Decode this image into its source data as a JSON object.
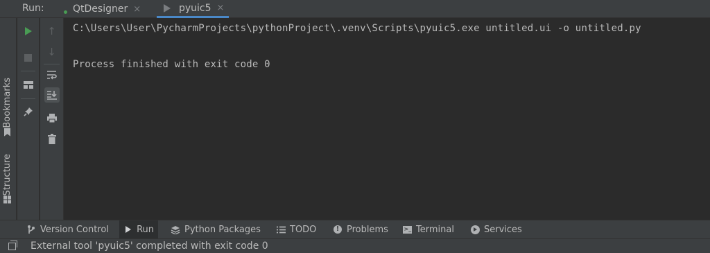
{
  "header": {
    "run_label": "Run:",
    "tabs": [
      {
        "label": "QtDesigner",
        "close": "×"
      },
      {
        "label": "pyuic5",
        "close": "×"
      }
    ]
  },
  "left_strip": {
    "bookmarks_label": "Bookmarks",
    "structure_label": "Structure"
  },
  "toolbar_icons": {
    "rerun": "play-icon",
    "stop": "stop-icon",
    "layout": "layout-icon",
    "pin": "pin-icon",
    "up": "↑",
    "down": "↓",
    "soft_wrap": "⮐",
    "scroll_end": "⭳",
    "print": "print-icon",
    "clear": "trash-icon"
  },
  "console": {
    "lines": [
      "C:\\Users\\User\\PycharmProjects\\pythonProject\\.venv\\Scripts\\pyuic5.exe untitled.ui -o untitled.py",
      "Process finished with exit code 0"
    ]
  },
  "tool_windows": [
    {
      "label": "Version Control",
      "icon": "branch-icon"
    },
    {
      "label": "Run",
      "icon": "run-icon",
      "active": true
    },
    {
      "label": "Python Packages",
      "icon": "layers-icon"
    },
    {
      "label": "TODO",
      "icon": "list-icon"
    },
    {
      "label": "Problems",
      "icon": "info-icon"
    },
    {
      "label": "Terminal",
      "icon": "terminal-icon"
    },
    {
      "label": "Services",
      "icon": "services-icon"
    }
  ],
  "status_bar": {
    "message": "External tool 'pyuic5' completed with exit code 0"
  },
  "colors": {
    "background": "#2b2b2b",
    "panel": "#3c3f41",
    "text": "#bbbbbb",
    "green": "#499c54",
    "accent": "#4a88c7"
  }
}
